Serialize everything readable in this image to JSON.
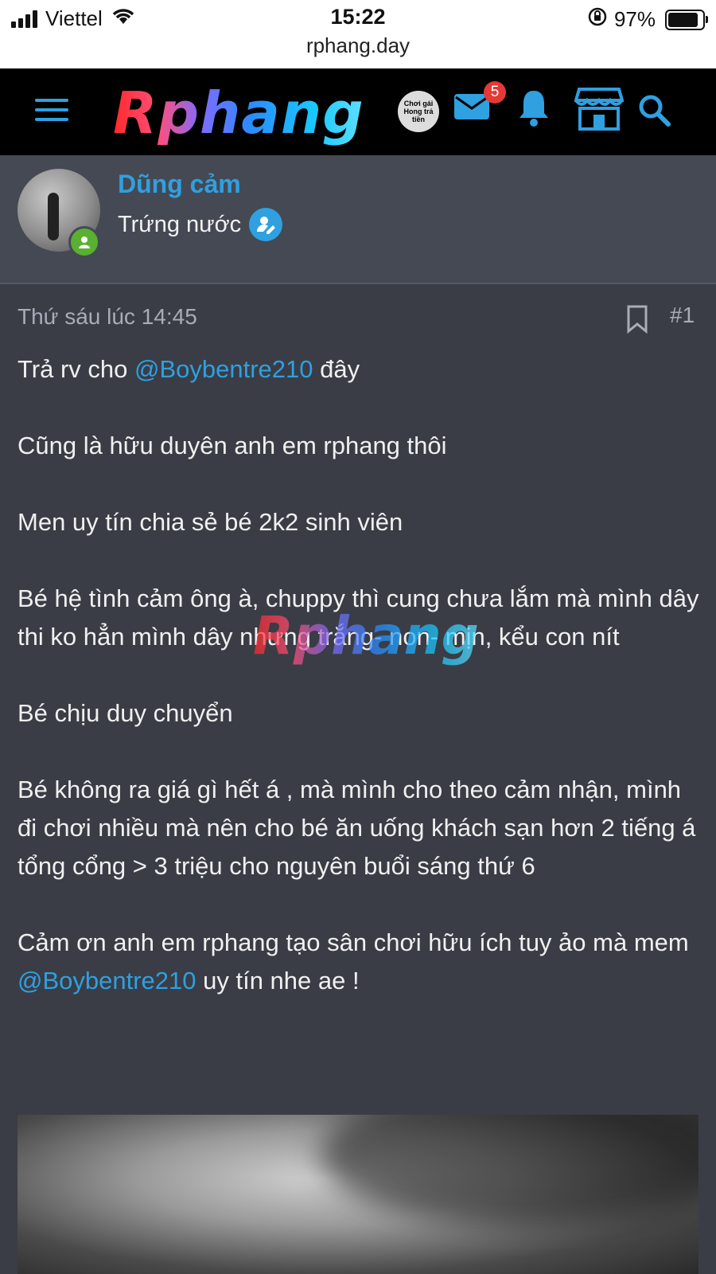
{
  "status_bar": {
    "carrier": "Viettel",
    "time": "15:22",
    "url": "rphang.day",
    "battery": "97%",
    "battery_level": 0.97
  },
  "navbar": {
    "logo": "Rphang",
    "avatar_caption": "Chơi gái Hong trả tiền",
    "mail_badge": "5",
    "icons": [
      "menu-icon",
      "mail-icon",
      "bell-icon",
      "store-icon",
      "search-icon"
    ],
    "accent": "#2fa0e0"
  },
  "user": {
    "name": "Dũng cảm",
    "title": "Trứng nước",
    "status_color": "#5ab031"
  },
  "post": {
    "time": "Thứ sáu lúc 14:45",
    "number": "#1",
    "line1_pre": "Trả rv cho ",
    "line1_mention": "@Boybentre210",
    "line1_post": " đây",
    "p2": "Cũng là hữu duyên anh em rphang thôi",
    "p3": "Men uy tín chia sẻ bé 2k2 sinh viên",
    "p4": "Bé hệ tình cảm ông à, chuppy thì cung chưa lắm mà mình dây thi ko hẳn mình dây nhưng trắng- non- mịn, kểu con nít",
    "p5": "Bé chịu duy chuyển",
    "p6": "Bé không ra giá gì hết á , mà mình cho theo cảm nhận, mình đi chơi nhiều mà nên cho bé ăn uống khách sạn hơn 2 tiếng á tổng cổng > 3 triệu cho nguyên buổi sáng thứ 6",
    "p7_pre": "Cảm ơn anh em rphang tạo sân chơi hữu ích tuy ảo mà mem ",
    "p7_mention": "@Boybentre210",
    "p7_post": " uy tín nhe ae !",
    "watermark": "Rphang"
  }
}
